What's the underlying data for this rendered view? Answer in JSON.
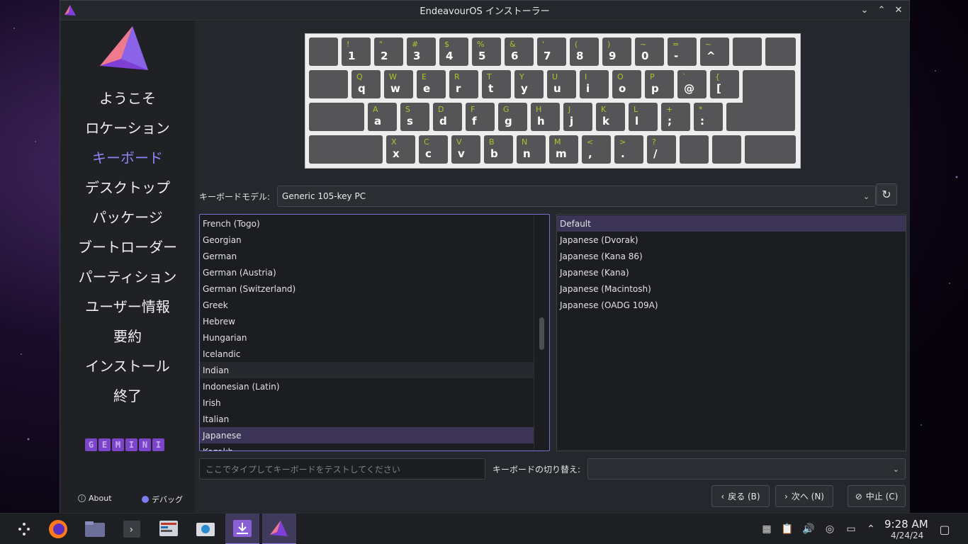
{
  "window": {
    "title": "EndeavourOS インストーラー"
  },
  "sidebar": {
    "steps": [
      {
        "label": "ようこそ",
        "active": false
      },
      {
        "label": "ロケーション",
        "active": false
      },
      {
        "label": "キーボード",
        "active": true
      },
      {
        "label": "デスクトップ",
        "active": false
      },
      {
        "label": "パッケージ",
        "active": false
      },
      {
        "label": "ブートローダー",
        "active": false
      },
      {
        "label": "パーティション",
        "active": false
      },
      {
        "label": "ユーザー情報",
        "active": false
      },
      {
        "label": "要約",
        "active": false
      },
      {
        "label": "インストール",
        "active": false
      },
      {
        "label": "終了",
        "active": false
      }
    ],
    "brand_letters": [
      "G",
      "E",
      "M",
      "I",
      "N",
      "I"
    ],
    "about_label": "About",
    "debug_label": "デバッグ"
  },
  "keyboard_preview": {
    "rows": [
      [
        [
          "",
          ""
        ],
        [
          "!",
          "1"
        ],
        [
          "\"",
          "2"
        ],
        [
          "#",
          "3"
        ],
        [
          "$",
          "4"
        ],
        [
          "%",
          "5"
        ],
        [
          "&",
          "6"
        ],
        [
          "'",
          "7"
        ],
        [
          "(",
          "8"
        ],
        [
          ")",
          "9"
        ],
        [
          "~",
          "0"
        ],
        [
          "=",
          "-"
        ],
        [
          "~",
          "^"
        ],
        [
          "",
          ""
        ],
        [
          "",
          ""
        ]
      ],
      [
        [
          "",
          ""
        ],
        [
          "Q",
          "q"
        ],
        [
          "W",
          "w"
        ],
        [
          "E",
          "e"
        ],
        [
          "R",
          "r"
        ],
        [
          "T",
          "t"
        ],
        [
          "Y",
          "y"
        ],
        [
          "U",
          "u"
        ],
        [
          "I",
          "i"
        ],
        [
          "O",
          "o"
        ],
        [
          "P",
          "p"
        ],
        [
          "`",
          "@"
        ],
        [
          "{",
          "["
        ],
        [
          "",
          ""
        ]
      ],
      [
        [
          "",
          ""
        ],
        [
          "A",
          "a"
        ],
        [
          "S",
          "s"
        ],
        [
          "D",
          "d"
        ],
        [
          "F",
          "f"
        ],
        [
          "G",
          "g"
        ],
        [
          "H",
          "h"
        ],
        [
          "J",
          "j"
        ],
        [
          "K",
          "k"
        ],
        [
          "L",
          "l"
        ],
        [
          "+",
          ";"
        ],
        [
          "*",
          ":"
        ],
        [
          "",
          ""
        ]
      ],
      [
        [
          "",
          ""
        ],
        [
          "X",
          "x"
        ],
        [
          "C",
          "c"
        ],
        [
          "V",
          "v"
        ],
        [
          "B",
          "b"
        ],
        [
          "N",
          "n"
        ],
        [
          "M",
          "m"
        ],
        [
          "<",
          ","
        ],
        [
          ">",
          "."
        ],
        [
          "?",
          "/"
        ],
        [
          "",
          ""
        ],
        [
          "",
          ""
        ],
        [
          "",
          ""
        ]
      ]
    ]
  },
  "model": {
    "label": "キーボードモデル:",
    "value": "Generic 105-key PC"
  },
  "layouts": {
    "items": [
      "French (Togo)",
      "Georgian",
      "German",
      "German (Austria)",
      "German (Switzerland)",
      "Greek",
      "Hebrew",
      "Hungarian",
      "Icelandic",
      "Indian",
      "Indonesian (Latin)",
      "Irish",
      "Italian",
      "Japanese",
      "Kazakh"
    ],
    "hovered": "Indian",
    "selected": "Japanese"
  },
  "variants": {
    "items": [
      "Default",
      "Japanese (Dvorak)",
      "Japanese (Kana 86)",
      "Japanese (Kana)",
      "Japanese (Macintosh)",
      "Japanese (OADG 109A)"
    ],
    "selected": "Default"
  },
  "test_input": {
    "placeholder": "ここでタイプしてキーボードをテストしてください"
  },
  "switch": {
    "label": "キーボードの切り替え:",
    "value": ""
  },
  "buttons": {
    "back": "戻る (B)",
    "next": "次へ (N)",
    "cancel": "中止 (C)"
  },
  "taskbar": {
    "time": "9:28 AM",
    "date": "4/24/24"
  }
}
